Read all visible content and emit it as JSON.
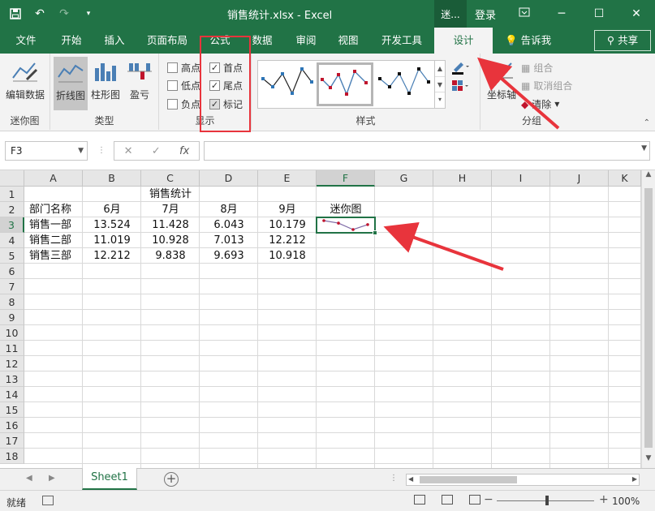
{
  "window": {
    "title": "销售统计.xlsx - Excel",
    "context_tab": "迷...",
    "login": "登录",
    "min": "─",
    "restore": "☐",
    "close": "✕"
  },
  "tabs": [
    {
      "label": "文件"
    },
    {
      "label": "开始"
    },
    {
      "label": "插入"
    },
    {
      "label": "页面布局"
    },
    {
      "label": "公式"
    },
    {
      "label": "数据"
    },
    {
      "label": "审阅"
    },
    {
      "label": "视图"
    },
    {
      "label": "开发工具"
    },
    {
      "label": "设计"
    }
  ],
  "tell_me": "告诉我",
  "share": "共享",
  "ribbon": {
    "sparkline_group": {
      "edit_data": "编辑数据",
      "label": "迷你图"
    },
    "type_group": {
      "line": "折线图",
      "column": "柱形图",
      "winloss": "盈亏",
      "label": "类型"
    },
    "show_group": {
      "high_point": "高点",
      "low_point": "低点",
      "negative_point": "负点",
      "first_point": "首点",
      "last_point": "尾点",
      "markers": "标记",
      "label": "显示",
      "checked": {
        "high_point": false,
        "low_point": false,
        "negative_point": false,
        "first_point": true,
        "last_point": true,
        "markers": true
      }
    },
    "style_group": {
      "label": "样式"
    },
    "group_group": {
      "axis": "坐标轴",
      "group": "组合",
      "ungroup": "取消组合",
      "clear": "清除",
      "label": "分组"
    }
  },
  "formula_bar": {
    "name_box": "F3",
    "formula": ""
  },
  "sheet": {
    "columns": [
      "A",
      "B",
      "C",
      "D",
      "E",
      "F",
      "G",
      "H",
      "I",
      "J",
      "K"
    ],
    "rows": [
      "1",
      "2",
      "3",
      "4",
      "5",
      "6",
      "7",
      "8",
      "9",
      "10",
      "11",
      "12",
      "13",
      "14",
      "15",
      "16",
      "17",
      "18"
    ],
    "title": "销售统计",
    "header": [
      "部门名称",
      "6月",
      "7月",
      "8月",
      "9月",
      "迷你图"
    ],
    "data": [
      {
        "dept": "销售一部",
        "m6": "13.524",
        "m7": "11.428",
        "m8": "6.043",
        "m9": "10.179"
      },
      {
        "dept": "销售二部",
        "m6": "11.019",
        "m7": "10.928",
        "m8": "7.013",
        "m9": "12.212"
      },
      {
        "dept": "销售三部",
        "m6": "12.212",
        "m7": "9.838",
        "m8": "9.693",
        "m9": "10.918"
      }
    ],
    "sparkline_values": [
      13.524,
      11.428,
      6.043,
      10.179
    ],
    "selected_cell": "F3"
  },
  "sheet_tab": "Sheet1",
  "status": {
    "ready": "就绪",
    "zoom": "100%"
  },
  "colors": {
    "excel_green": "#217346",
    "highlight_red": "#e8343c",
    "sparkline_line": "#7f6aa6",
    "sparkline_marker": "#c0142c"
  }
}
